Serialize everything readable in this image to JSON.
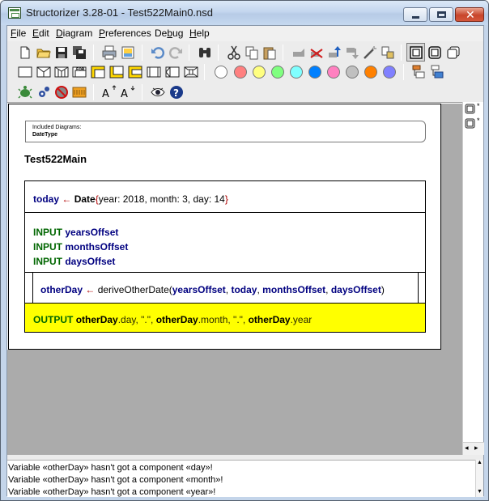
{
  "window": {
    "title": "Structorizer 3.28-01 - Test522Main0.nsd",
    "controls": {
      "minimize_icon": "minimize-icon",
      "maximize_icon": "maximize-icon",
      "close_icon": "close-icon"
    }
  },
  "menubar": {
    "items": [
      {
        "label": "File",
        "mnemonic": "F",
        "rest": "ile"
      },
      {
        "label": "Edit",
        "mnemonic": "E",
        "rest": "dit"
      },
      {
        "label": "Diagram",
        "mnemonic": "D",
        "rest": "iagram"
      },
      {
        "label": "Preferences",
        "mnemonic": "P",
        "rest": "references"
      },
      {
        "label": "Debug",
        "mnemonic": "D",
        "prefix": "De",
        "rest": "bug"
      },
      {
        "label": "Help",
        "mnemonic": "H",
        "rest": "elp"
      }
    ]
  },
  "toolbar": {
    "colors": [
      "#ffffff",
      "#ff8080",
      "#ffff80",
      "#80ff80",
      "#80ffff",
      "#0080ff",
      "#ff80c0",
      "#c0c0c0",
      "#ff8000",
      "#8080ff"
    ]
  },
  "diagram": {
    "included_title": "Included Diagrams:",
    "included_name": "DateType",
    "name": "Test522Main",
    "el1": {
      "var": "today",
      "arrow": "←",
      "fn": "Date",
      "open": "{",
      "args": "year: 2018, month: 3, day: 14",
      "close": "}"
    },
    "el2": [
      {
        "kw": "INPUT",
        "var": "yearsOffset"
      },
      {
        "kw": "INPUT",
        "var": "monthsOffset"
      },
      {
        "kw": "INPUT",
        "var": "daysOffset"
      }
    ],
    "el3": {
      "var": "otherDay",
      "arrow": "←",
      "fn": "deriveOtherDate(",
      "a1": "yearsOffset",
      "sep1": ", ",
      "a2": "today",
      "sep2": ", ",
      "a3": "monthsOffset",
      "sep3": ", ",
      "a4": "daysOffset",
      "close": ")"
    },
    "el4": {
      "kw": "OUTPUT",
      "v1": "otherDay",
      "f1": ".day, \".\", ",
      "v2": "otherDay",
      "f2": ".month, \".\", ",
      "v3": "otherDay",
      "f3": ".year"
    }
  },
  "messages": [
    "Variable «otherDay» hasn't got a component «day»!",
    "Variable «otherDay» hasn't got a component «month»!",
    "Variable «otherDay» hasn't got a component «year»!"
  ]
}
